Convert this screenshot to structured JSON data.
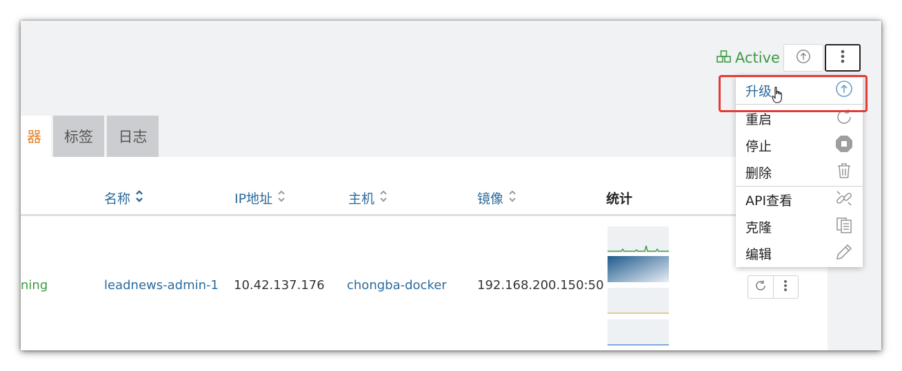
{
  "header": {
    "status_label": "Active",
    "status_icon": "cubes-icon",
    "upgrade_icon": "arrow-up-circle-icon",
    "more_icon": "vertical-dots-icon"
  },
  "tabs": [
    {
      "label": "容器",
      "visible_text": "器",
      "active": true
    },
    {
      "label": "标签",
      "active": false
    },
    {
      "label": "日志",
      "active": false
    }
  ],
  "table": {
    "columns": [
      "名称",
      "IP地址",
      "主机",
      "镜像",
      "统计"
    ],
    "rows": [
      {
        "state": "ning",
        "name": "leadnews-admin-1",
        "ip": "10.42.137.176",
        "host": "chongba-docker",
        "image": "192.168.200.150:50"
      }
    ]
  },
  "menu": {
    "items": [
      {
        "label": "升级",
        "icon": "arrow-up-circle-icon",
        "highlighted": true
      },
      {
        "label": "重启",
        "icon": "restart-icon"
      },
      {
        "label": "停止",
        "icon": "stop-icon"
      },
      {
        "label": "删除",
        "icon": "trash-icon"
      },
      {
        "label": "API查看",
        "icon": "link-icon"
      },
      {
        "label": "克隆",
        "icon": "copy-icon"
      },
      {
        "label": "编辑",
        "icon": "pencil-icon"
      }
    ]
  },
  "colors": {
    "accent_blue": "#2a6a9c",
    "active_green": "#3d9a45",
    "active_tab_orange": "#e67e22",
    "highlight_red": "#e53935"
  }
}
